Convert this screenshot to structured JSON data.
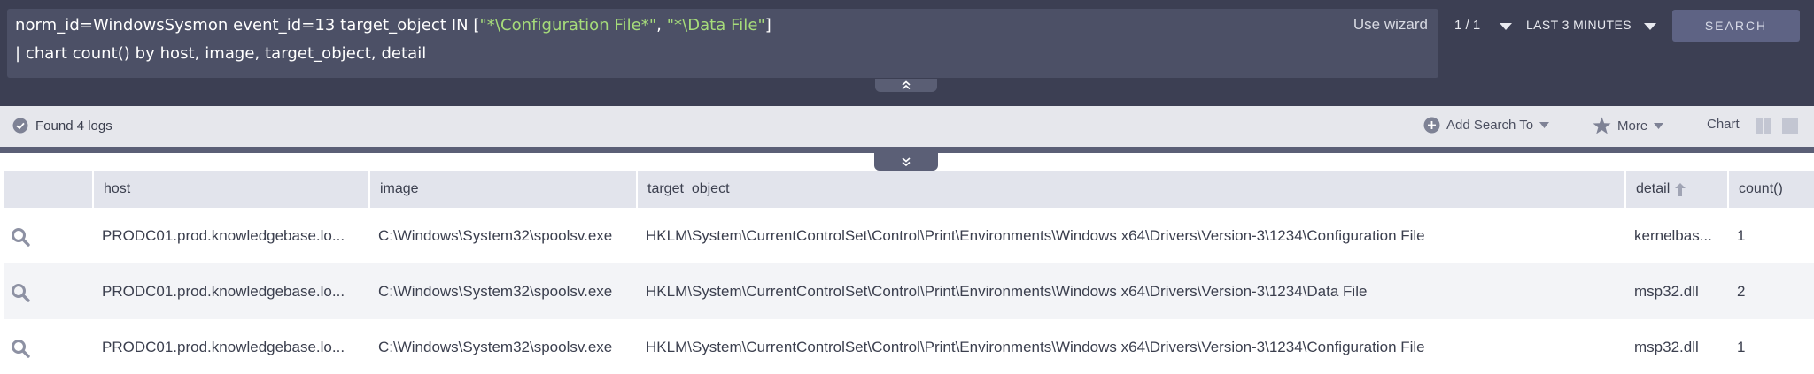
{
  "query": {
    "line1_prefix": "norm_id=WindowsSysmon event_id=13 target_object IN [",
    "line1_str1": "\"*\\Configuration File*\"",
    "line1_comma": ", ",
    "line1_str2": "\"*\\Data File\"",
    "line1_suffix": "]",
    "line2": "| chart count() by host, image, target_object, detail",
    "use_wizard": "Use wizard"
  },
  "pagination": "1 / 1",
  "time_range": "LAST 3 MINUTES",
  "search_button": "SEARCH",
  "status": {
    "found": "Found 4 logs",
    "add_search_to": "Add Search To",
    "more": "More",
    "chart": "Chart"
  },
  "table": {
    "columns": [
      "host",
      "image",
      "target_object",
      "detail",
      "count()"
    ],
    "rows": [
      {
        "host": "PRODC01.prod.knowledgebase.lo...",
        "image": "C:\\Windows\\System32\\spoolsv.exe",
        "target_object": "HKLM\\System\\CurrentControlSet\\Control\\Print\\Environments\\Windows x64\\Drivers\\Version-3\\1234\\Configuration File",
        "detail": "kernelbas...",
        "count": "1"
      },
      {
        "host": "PRODC01.prod.knowledgebase.lo...",
        "image": "C:\\Windows\\System32\\spoolsv.exe",
        "target_object": "HKLM\\System\\CurrentControlSet\\Control\\Print\\Environments\\Windows x64\\Drivers\\Version-3\\1234\\Data File",
        "detail": "msp32.dll",
        "count": "2"
      },
      {
        "host": "PRODC01.prod.knowledgebase.lo...",
        "image": "C:\\Windows\\System32\\spoolsv.exe",
        "target_object": "HKLM\\System\\CurrentControlSet\\Control\\Print\\Environments\\Windows x64\\Drivers\\Version-3\\1234\\Configuration File",
        "detail": "msp32.dll",
        "count": "1"
      }
    ]
  },
  "icons": {
    "found": "check-circle-icon",
    "add_search_to": "plus-circle-icon",
    "more": "star-icon",
    "row_action": "magnifier-icon",
    "sort": "sort-up-arrow-icon"
  },
  "colors": {
    "topbar": "#3c3f53",
    "query_box": "#4c5066",
    "query_string": "#a6dc7a",
    "search_button": "#5e6384",
    "status_bar": "#e6e7ec",
    "table_header": "#e2e4ec",
    "row_alt": "#f3f4f7"
  }
}
